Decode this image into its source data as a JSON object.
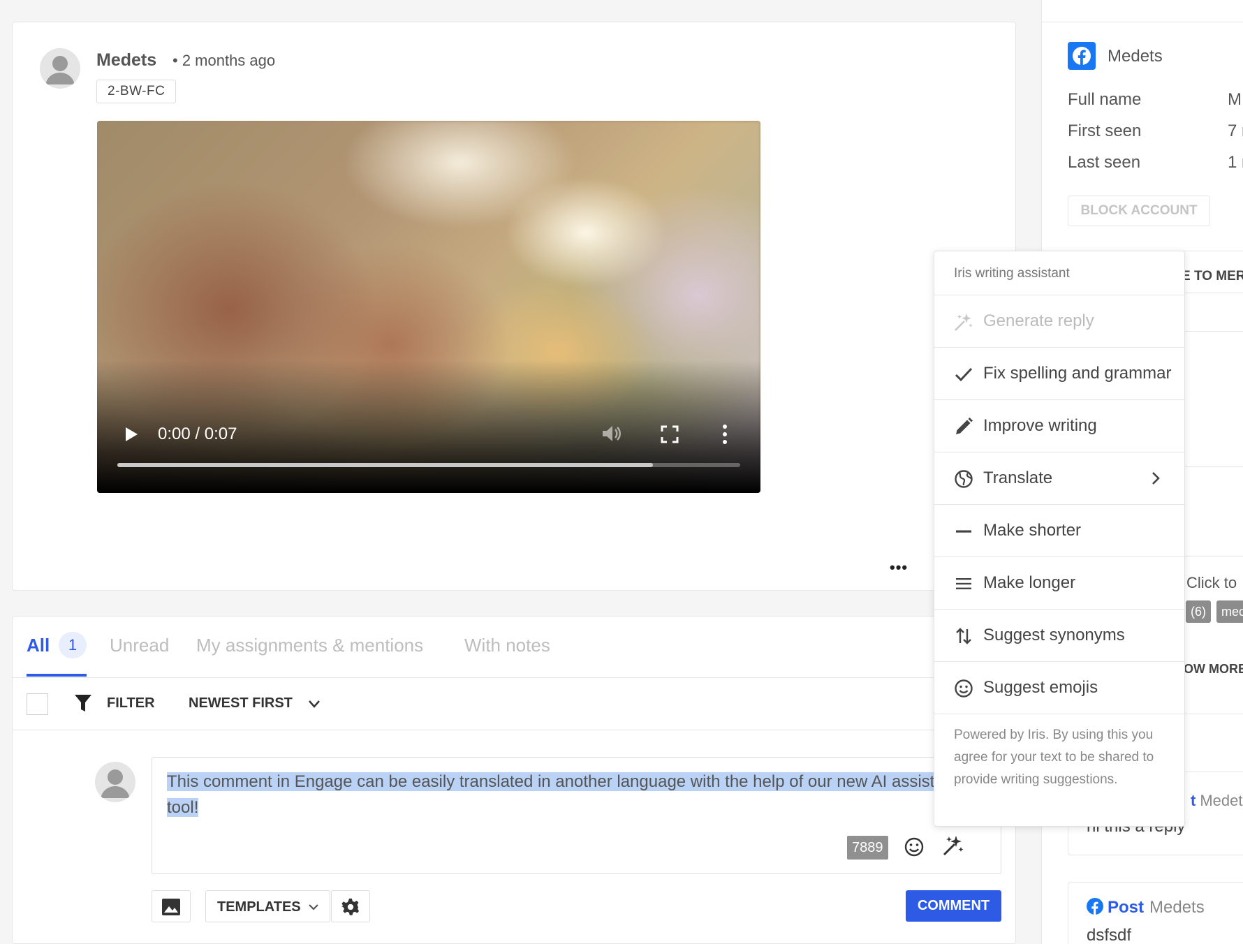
{
  "post": {
    "author": "Medets",
    "time": "• 2 months ago",
    "tag": "2-BW-FC",
    "video": {
      "time_display": "0:00 / 0:07",
      "progress": 0.86
    },
    "more_icon": "more-horizontal-icon"
  },
  "tabs": [
    {
      "label": "All",
      "count": "1"
    },
    {
      "label": "Unread"
    },
    {
      "label": "My assignments & mentions"
    },
    {
      "label": "With notes"
    }
  ],
  "toolbar": {
    "filter_label": "FILTER",
    "sort_label": "NEWEST FIRST"
  },
  "reply": {
    "text": "This comment in Engage can be easily translated in another language with the help of our new AI assistant tool!",
    "char_count": "7889",
    "templates_label": "TEMPLATES",
    "comment_label": "COMMENT"
  },
  "profile": {
    "name": "Medets",
    "rows": [
      {
        "label": "Full name",
        "value": "M"
      },
      {
        "label": "First seen",
        "value": "7 r"
      },
      {
        "label": "Last seen",
        "value": "1 r"
      }
    ],
    "block_label": "BLOCK ACCOUNT",
    "assign_label": "E TO MER",
    "click_to": "Click to",
    "chips": [
      "(6)",
      "mec"
    ],
    "show_more": "OW MORE",
    "reply_card": {
      "name_fragment": "t",
      "name": "Medet",
      "text": "hi this a reply"
    },
    "post_card": {
      "label": "Post",
      "name": "Medets",
      "text": "dsfsdf"
    }
  },
  "iris": {
    "title": "Iris writing assistant",
    "items": [
      {
        "label": "Generate reply",
        "icon": "sparkle-icon",
        "disabled": true
      },
      {
        "label": "Fix spelling and grammar",
        "icon": "check-icon"
      },
      {
        "label": "Improve writing",
        "icon": "pencil-icon"
      },
      {
        "label": "Translate",
        "icon": "globe-icon"
      },
      {
        "label": "Make shorter",
        "icon": "minus-icon"
      },
      {
        "label": "Make longer",
        "icon": "lines-icon"
      },
      {
        "label": "Suggest synonyms",
        "icon": "swap-arrows-icon"
      },
      {
        "label": "Suggest emojis",
        "icon": "emoji-icon"
      }
    ],
    "footer": "Powered by Iris. By using this you agree for your text to be shared to provide writing suggestions."
  },
  "colors": {
    "accent": "#2e5be6",
    "facebook": "#1877f2",
    "highlight": "#b9d2f5"
  }
}
